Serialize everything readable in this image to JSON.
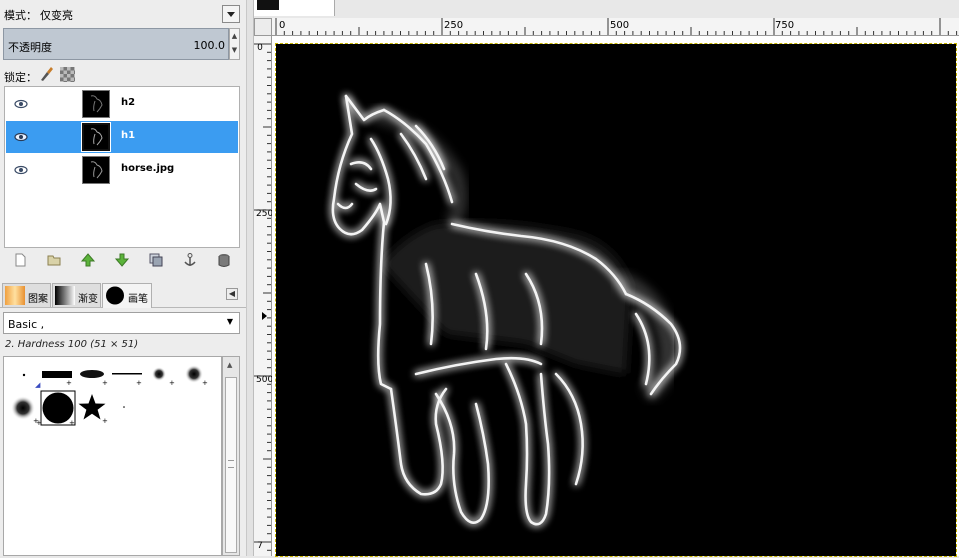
{
  "mode": {
    "label": "模式：",
    "value": "仅变亮"
  },
  "opacity": {
    "label": "不透明度",
    "value": "100.0"
  },
  "lock": {
    "label": "锁定："
  },
  "layers": [
    {
      "name": "h2",
      "selected": false
    },
    {
      "name": "h1",
      "selected": true
    },
    {
      "name": "horse.jpg",
      "selected": false
    }
  ],
  "layer_toolbar": [
    "new-layer-icon",
    "open-folder-icon",
    "raise-layer-icon",
    "lower-layer-icon",
    "duplicate-layer-icon",
    "anchor-icon",
    "delete-layer-icon"
  ],
  "tabs": [
    {
      "label": "图案",
      "icon": "pattern-icon"
    },
    {
      "label": "渐变",
      "icon": "gradient-icon"
    },
    {
      "label": "画笔",
      "icon": "brush-icon",
      "active": true
    }
  ],
  "brush_select": {
    "value": "Basic ,"
  },
  "brush_info": "2. Hardness 100 (51 × 51)",
  "ruler_h": {
    "ticks": [
      "0",
      "250",
      "500",
      "750"
    ]
  },
  "ruler_v": {
    "ticks": [
      "0",
      "250",
      "500",
      "7"
    ]
  },
  "colors": {
    "selection": "#3b9cf1",
    "canvas": "#000000",
    "opacity_bg": "#bfc8d2"
  }
}
